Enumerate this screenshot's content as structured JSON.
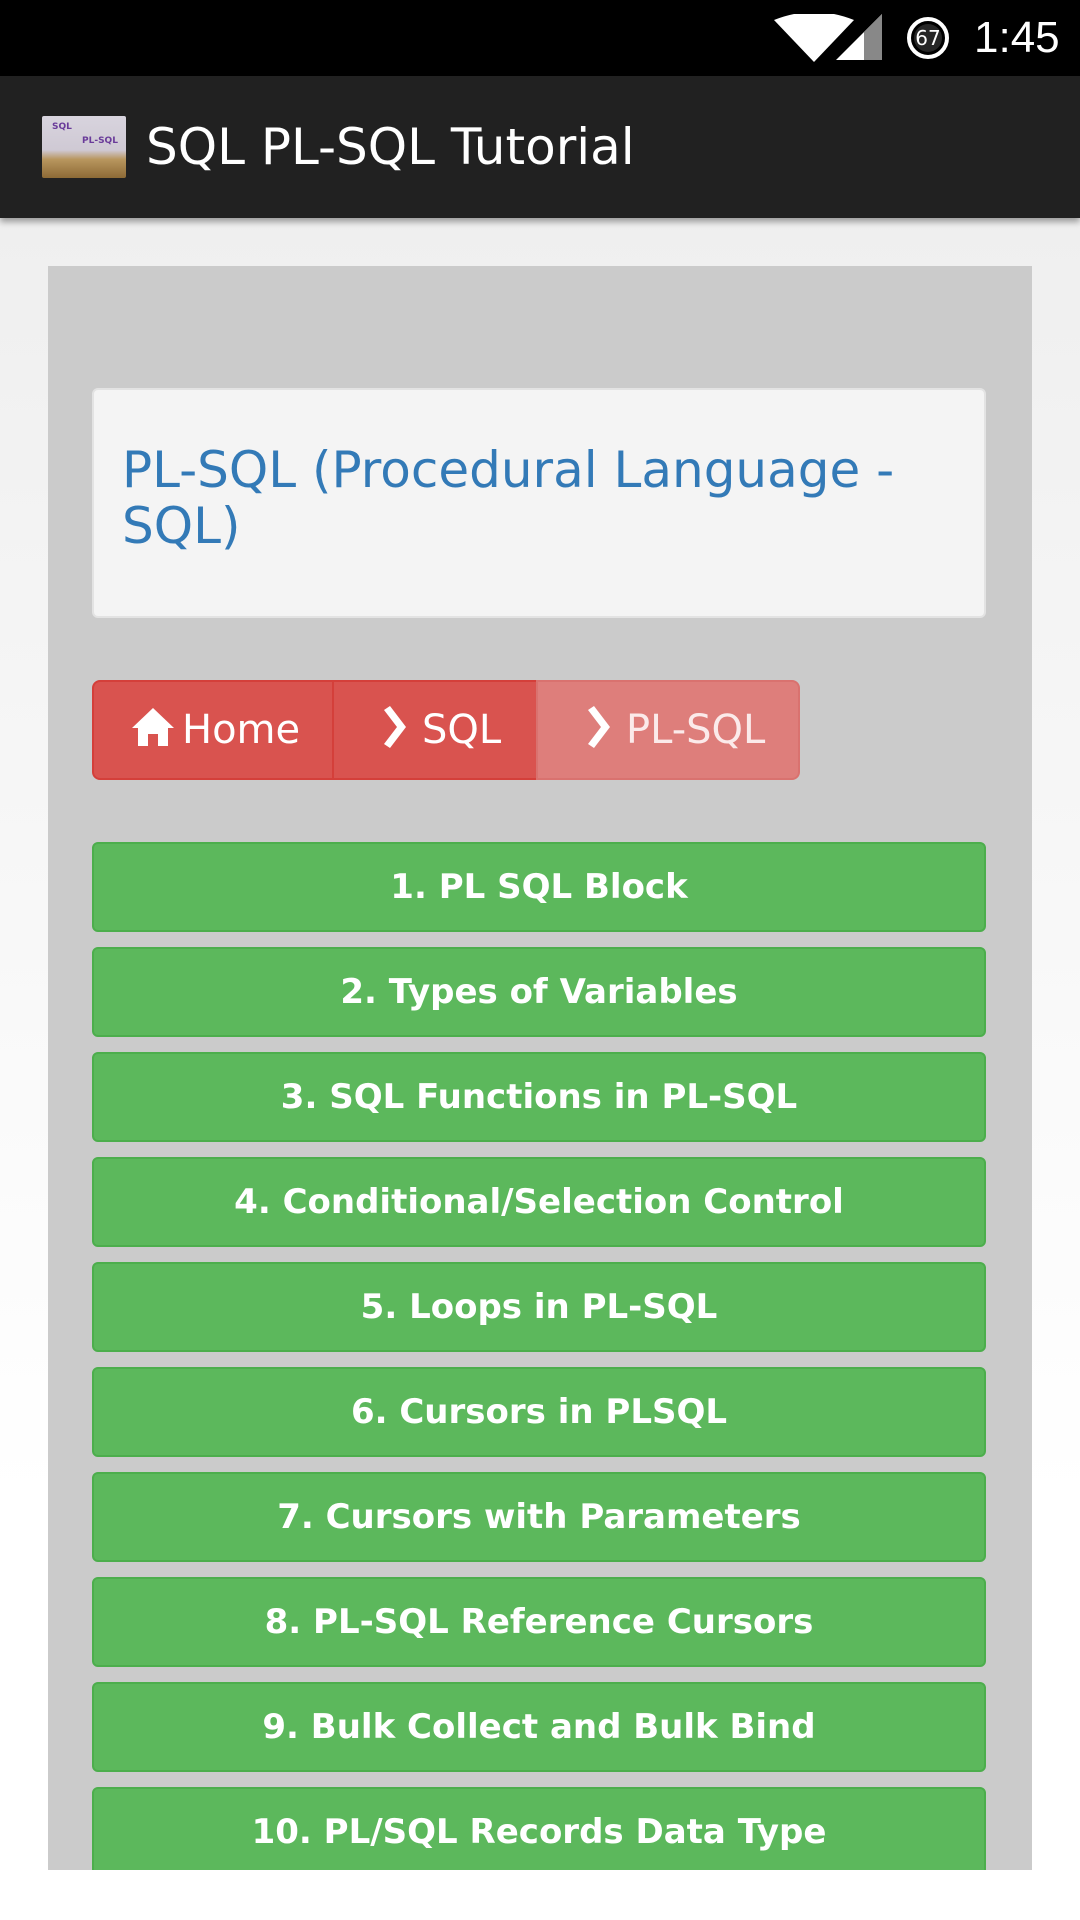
{
  "status_bar": {
    "time": "1:45",
    "battery_level": "67",
    "icons": [
      "wifi-icon",
      "cell-signal-icon",
      "battery-icon"
    ]
  },
  "app_bar": {
    "title": "SQL PL-SQL Tutorial",
    "logo_text_top": "SQL",
    "logo_text_bottom": "PL-SQL"
  },
  "page": {
    "heading": "PL-SQL (Procedural Language - SQL)"
  },
  "breadcrumb": {
    "items": [
      {
        "label": "Home",
        "icon": "home-icon"
      },
      {
        "label": "SQL",
        "icon": "chevron-right-icon"
      },
      {
        "label": "PL-SQL",
        "icon": "chevron-right-icon"
      }
    ]
  },
  "lessons": [
    "1. PL SQL Block",
    "2. Types of Variables",
    "3. SQL Functions in PL-SQL",
    "4. Conditional/Selection Control",
    "5. Loops in PL-SQL",
    "6. Cursors in PLSQL",
    "7. Cursors with Parameters",
    "8. PL-SQL Reference Cursors",
    "9. Bulk Collect and Bulk Bind",
    "10. PL/SQL Records Data Type"
  ],
  "colors": {
    "heading": "#337ab7",
    "breadcrumb_active": "#d9534f",
    "breadcrumb_current": "#de7e7b",
    "lesson_button": "#5cb85c",
    "app_bar": "#212121",
    "panel": "#cbcbcb"
  }
}
